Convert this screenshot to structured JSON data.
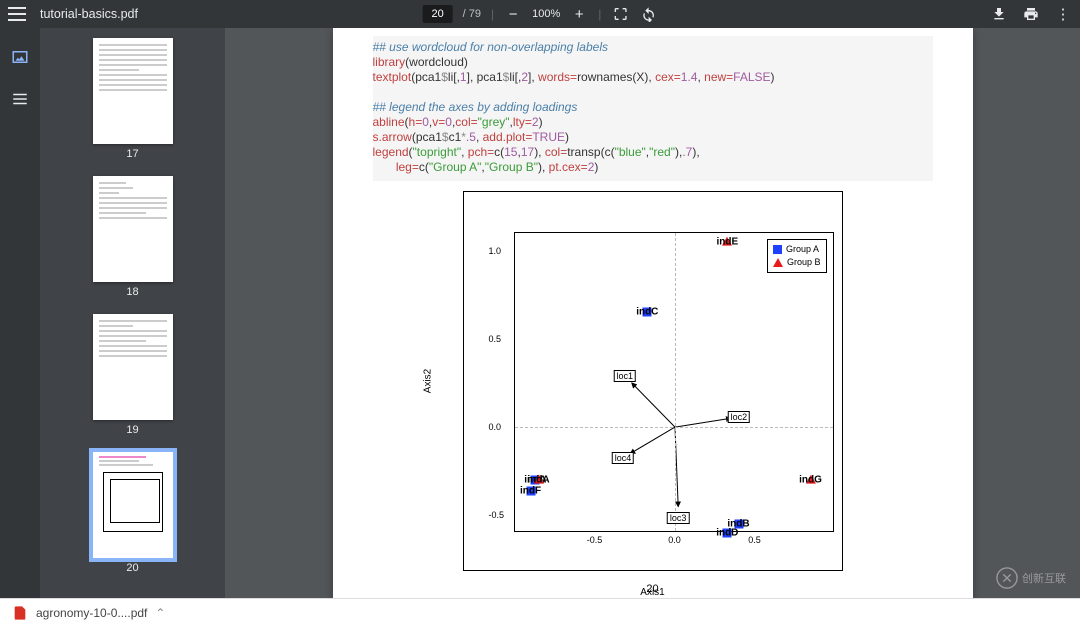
{
  "header": {
    "filename": "tutorial-basics.pdf",
    "current_page": "20",
    "total_pages": "/ 79",
    "zoom": "100%"
  },
  "thumbs": [
    {
      "num": "17"
    },
    {
      "num": "18"
    },
    {
      "num": "19"
    },
    {
      "num": "20",
      "selected": true
    }
  ],
  "code_lines": [
    {
      "cls": "c-comment",
      "t": "## use wordcloud for non-overlapping labels"
    },
    {
      "html": "<span class=c-func>library</span>(wordcloud)"
    },
    {
      "html": "<span class=c-func>textplot</span>(pca1<span class=c-op>$</span>li[,<span class=c-num>1</span>], pca1<span class=c-op>$</span>li[,<span class=c-num>2</span>], <span class=c-kw>words=</span>rownames(X), <span class=c-kw>cex=</span><span class=c-num>1.4</span>, <span class=c-kw>new=</span><span class=c-num>FALSE</span>)"
    },
    {
      "t": ""
    },
    {
      "cls": "c-comment",
      "t": "## legend the axes by adding loadings"
    },
    {
      "html": "<span class=c-func>abline</span>(<span class=c-kw>h=</span><span class=c-num>0</span>,<span class=c-kw>v=</span><span class=c-num>0</span>,<span class=c-kw>col=</span><span class=c-str>\"grey\"</span>,<span class=c-kw>lty=</span><span class=c-num>2</span>)"
    },
    {
      "html": "<span class=c-func>s.arrow</span>(pca1<span class=c-op>$</span>c1<span class=c-op>*</span><span class=c-num>.5</span>, <span class=c-kw>add.plot=</span><span class=c-num>TRUE</span>)"
    },
    {
      "html": "<span class=c-func>legend</span>(<span class=c-str>\"topright\"</span>, <span class=c-kw>pch=</span>c(<span class=c-num>15</span>,<span class=c-num>17</span>), <span class=c-kw>col=</span>transp(c(<span class=c-str>\"blue\"</span>,<span class=c-str>\"red\"</span>),<span class=c-num>.7</span>),"
    },
    {
      "html": "       <span class=c-kw>leg=</span>c(<span class=c-str>\"Group A\"</span>,<span class=c-str>\"Group B\"</span>), <span class=c-kw>pt.cex=</span><span class=c-num>2</span>)"
    }
  ],
  "chart_data": {
    "type": "scatter",
    "xlabel": "Axis1",
    "ylabel": "Axis2",
    "xlim": [
      -1.0,
      1.0
    ],
    "ylim": [
      -0.6,
      1.1
    ],
    "x_ticks": [
      -0.5,
      0.0,
      0.5
    ],
    "y_ticks": [
      -0.5,
      0.0,
      0.5,
      1.0
    ],
    "series": [
      {
        "name": "Group A",
        "marker": "square",
        "color": "#1e40ff",
        "points": [
          {
            "label": "indA",
            "x": -0.87,
            "y": -0.3
          },
          {
            "label": "indB",
            "x": 0.4,
            "y": -0.55
          },
          {
            "label": "indC",
            "x": -0.17,
            "y": 0.65
          },
          {
            "label": "indD",
            "x": 0.33,
            "y": -0.6
          },
          {
            "label": "indF",
            "x": -0.9,
            "y": -0.36
          }
        ]
      },
      {
        "name": "Group B",
        "marker": "triangle",
        "color": "#e81b1b",
        "points": [
          {
            "label": "indA",
            "x": -0.85,
            "y": -0.3
          },
          {
            "label": "indE",
            "x": 0.33,
            "y": 1.05
          },
          {
            "label": "indG",
            "x": 0.85,
            "y": -0.3
          }
        ]
      }
    ],
    "arrows": [
      {
        "label": "loc1",
        "x": -0.27,
        "y": 0.25
      },
      {
        "label": "loc2",
        "x": 0.35,
        "y": 0.05
      },
      {
        "label": "loc3",
        "x": 0.02,
        "y": -0.45
      },
      {
        "label": "loc4",
        "x": -0.28,
        "y": -0.15
      }
    ],
    "legend": [
      "Group A",
      "Group B"
    ]
  },
  "page_footer_num": "20",
  "download_chip": "agronomy-10-0....pdf",
  "watermark": "创新互联"
}
